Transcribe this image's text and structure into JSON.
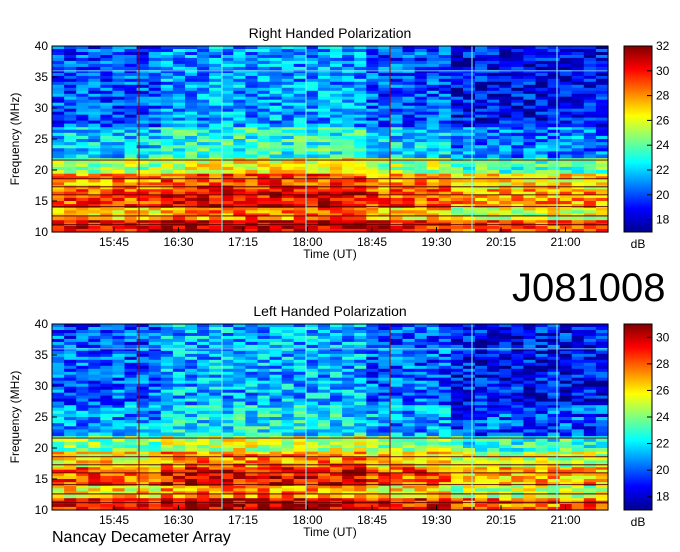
{
  "observation_id": "J081008",
  "footer": "Nancay Decameter Array",
  "chart_data": [
    {
      "type": "heatmap",
      "title": "Right Handed Polarization",
      "xlabel": "Time (UT)",
      "ylabel": "Frequency (MHz)",
      "x_ticks": [
        "15:45",
        "16:30",
        "17:15",
        "18:00",
        "18:45",
        "19:30",
        "20:15",
        "21:00"
      ],
      "y_ticks": [
        10,
        15,
        20,
        25,
        30,
        35,
        40
      ],
      "ylim": [
        10,
        40
      ],
      "colorbar": {
        "label": "dB",
        "ticks": [
          18,
          20,
          22,
          24,
          26,
          28,
          30,
          32
        ],
        "range": [
          17,
          32
        ]
      },
      "colormap": "jet",
      "bands": [
        {
          "freq_range": [
            10,
            12
          ],
          "level_db": 30
        },
        {
          "freq_range": [
            12,
            14
          ],
          "level_db": 27
        },
        {
          "freq_range": [
            14,
            17
          ],
          "level_db": 29
        },
        {
          "freq_range": [
            17,
            19.5
          ],
          "level_db": 28
        },
        {
          "freq_range": [
            19.5,
            22
          ],
          "level_db": 25
        },
        {
          "freq_range": [
            22,
            27
          ],
          "level_db": 22
        },
        {
          "freq_range": [
            27,
            40
          ],
          "level_db": 20
        }
      ]
    },
    {
      "type": "heatmap",
      "title": "Left Handed Polarization",
      "xlabel": "Time (UT)",
      "ylabel": "Frequency (MHz)",
      "x_ticks": [
        "15:45",
        "16:30",
        "17:15",
        "18:00",
        "18:45",
        "19:30",
        "20:15",
        "21:00"
      ],
      "y_ticks": [
        10,
        15,
        20,
        25,
        30,
        35,
        40
      ],
      "ylim": [
        10,
        40
      ],
      "colorbar": {
        "label": "dB",
        "ticks": [
          18,
          20,
          22,
          24,
          26,
          28,
          30
        ],
        "range": [
          17,
          31
        ]
      },
      "colormap": "jet",
      "bands": [
        {
          "freq_range": [
            10,
            12
          ],
          "level_db": 29
        },
        {
          "freq_range": [
            12,
            14
          ],
          "level_db": 26
        },
        {
          "freq_range": [
            14,
            17
          ],
          "level_db": 28
        },
        {
          "freq_range": [
            17,
            19.5
          ],
          "level_db": 26
        },
        {
          "freq_range": [
            19.5,
            22
          ],
          "level_db": 24
        },
        {
          "freq_range": [
            22,
            27
          ],
          "level_db": 21
        },
        {
          "freq_range": [
            27,
            40
          ],
          "level_db": 20
        }
      ]
    }
  ]
}
